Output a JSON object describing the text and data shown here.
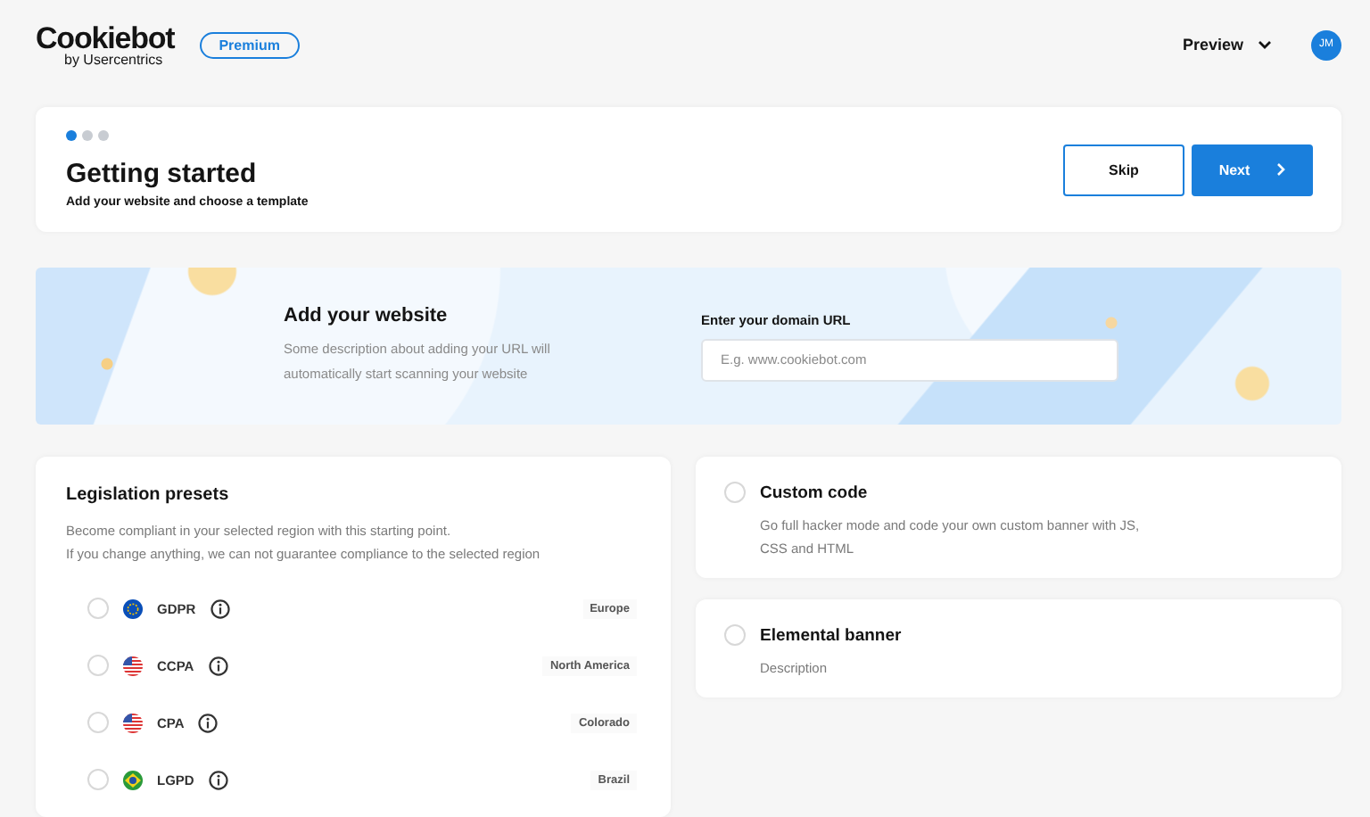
{
  "header": {
    "logo": {
      "name": "Cookiebot",
      "tagline": "by Usercentrics"
    },
    "plan_badge": "Premium",
    "preview_menu": "Preview",
    "avatar": "JM"
  },
  "intro": {
    "steps": [
      {
        "selected": true
      },
      {
        "selected": false
      },
      {
        "selected": false
      }
    ],
    "title": "Getting started",
    "subtitle": "Add your website and choose a template",
    "buttons": [
      {
        "label": "Skip",
        "kind": "secondary"
      },
      {
        "label": "Next",
        "kind": "primary"
      }
    ]
  },
  "website": {
    "title": "Add your website",
    "description": "Some description about adding your URL will automatically start scanning your website",
    "field_label": "Enter your domain URL",
    "placeholder": "E.g. www.cookiebot.com"
  },
  "legislation": {
    "title": "Legislation presets",
    "description": [
      "Become compliant in your selected region with this starting point.",
      "If you change anything, we can not guarantee compliance to the selected region"
    ],
    "presets": [
      {
        "name": "GDPR",
        "kind": "eu",
        "region": "Europe",
        "selected": false
      },
      {
        "name": "CCPA",
        "kind": "us",
        "region": "North America",
        "selected": false
      },
      {
        "name": "CPA",
        "kind": "us",
        "region": "Colorado",
        "selected": false
      },
      {
        "name": "LGPD",
        "kind": "br",
        "region": "Brazil",
        "selected": false
      }
    ]
  },
  "templates": [
    {
      "title": "Custom code",
      "description": "Go full hacker mode and code your own custom banner with JS, CSS and HTML",
      "selected": false
    },
    {
      "title": "Elemental banner",
      "description": "Description",
      "selected": false
    }
  ]
}
